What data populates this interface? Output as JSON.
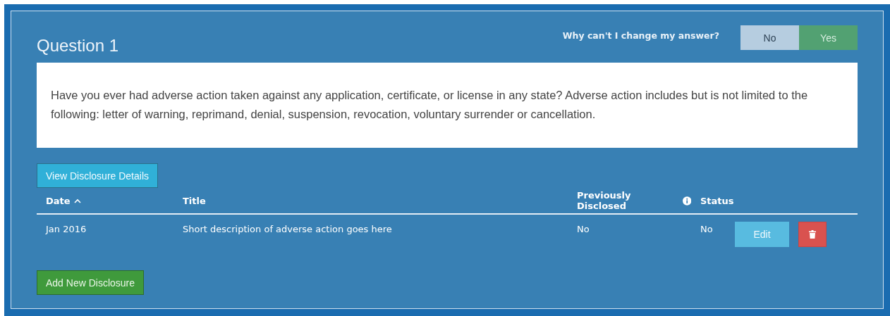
{
  "question": {
    "title": "Question 1",
    "text": "Have you ever had adverse action taken against any application, certificate, or license in any state? Adverse action includes but is not limited to the following: letter of warning, reprimand, denial, suspension, revocation, voluntary surrender or cancellation."
  },
  "answer": {
    "help_link": "Why can't I change my answer?",
    "options": [
      {
        "label": "No",
        "selected": false
      },
      {
        "label": "Yes",
        "selected": true
      }
    ]
  },
  "view_button": "View Disclosure Details",
  "table": {
    "columns": [
      {
        "label": "Date",
        "kind": "sorted"
      },
      {
        "label": "Title",
        "kind": "plain"
      },
      {
        "label": "Previously Disclosed",
        "kind": "info"
      },
      {
        "label": "Status",
        "kind": "plain"
      }
    ],
    "rows": [
      {
        "date": "Jan 2016",
        "title": "Short description of adverse action goes here",
        "previously_disclosed": "No",
        "status": "No",
        "edit": "Edit"
      }
    ]
  },
  "add_button": "Add New Disclosure"
}
